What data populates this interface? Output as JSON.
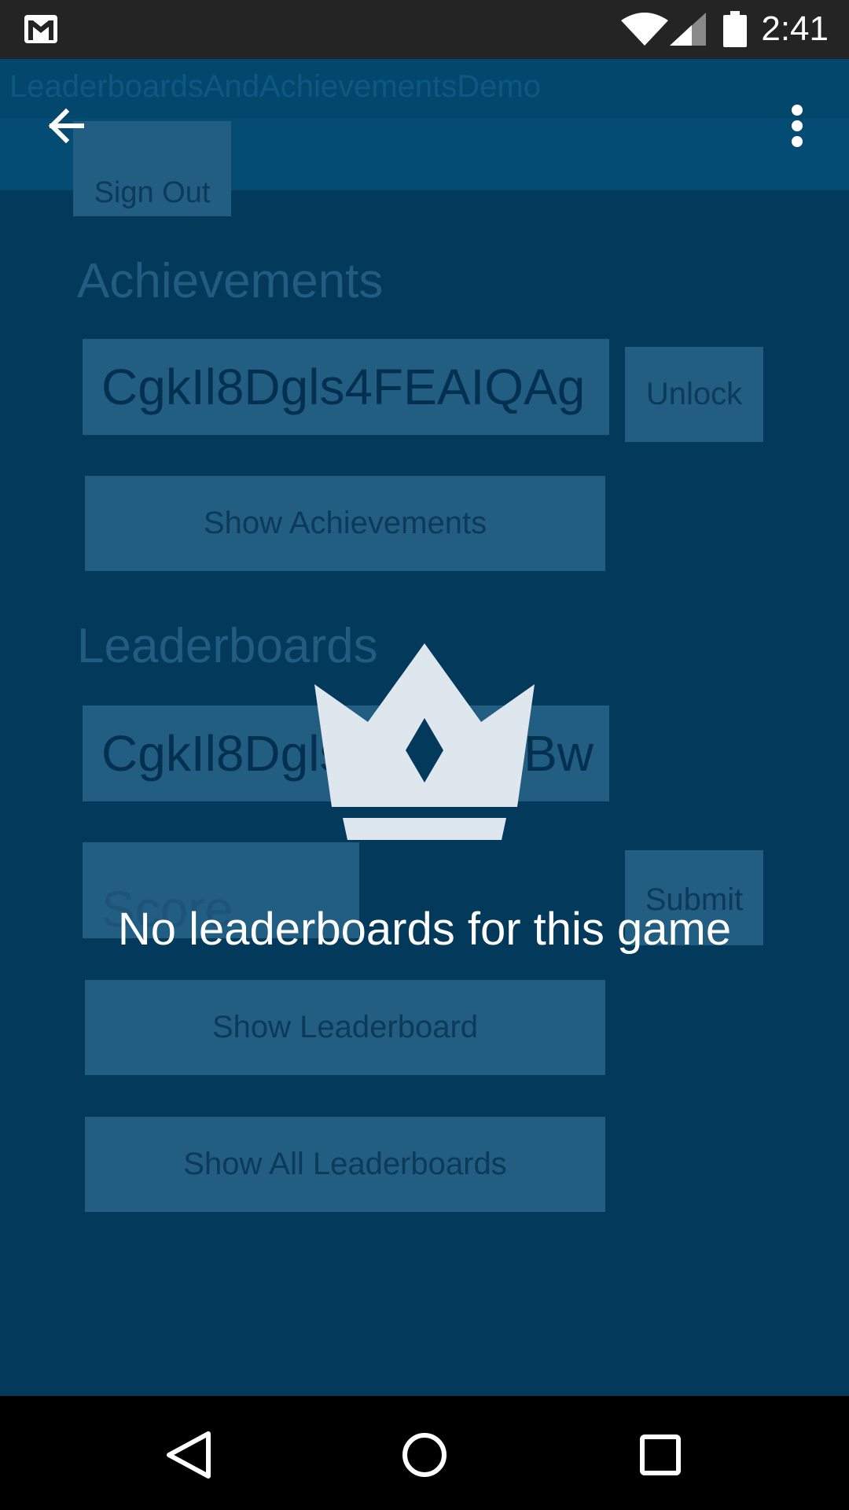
{
  "status_bar": {
    "time": "2:41",
    "icons": [
      "gmail-icon",
      "wifi-icon",
      "cell-signal-icon",
      "battery-icon"
    ]
  },
  "toolbar": {
    "title": "LeaderboardsAndAchievementsDemo",
    "back_icon": "arrow-back-icon",
    "overflow_icon": "more-vert-icon"
  },
  "background_app": {
    "sign_out_label": "Sign Out",
    "achievements_heading": "Achievements",
    "achievement_id": "CgkIl8Dgls4FEAIQAg",
    "unlock_label": "Unlock",
    "show_achievements_label": "Show Achievements",
    "leaderboards_heading": "Leaderboards",
    "leaderboard_id": "CgkIl8Dgls4FEAIQBw",
    "score_placeholder": "Score",
    "submit_label": "Submit",
    "show_leaderboard_label": "Show Leaderboard",
    "show_all_leaderboards_label": "Show All Leaderboards"
  },
  "empty_state": {
    "icon": "crown-icon",
    "message": "No leaderboards for this game"
  },
  "nav_bar": {
    "icons": [
      "back-triangle-icon",
      "home-circle-icon",
      "recents-square-icon"
    ]
  },
  "colors": {
    "background": "#033a5c",
    "toolbar": "#054c74",
    "status_bar": "#242424",
    "ghost_control": "#225d82",
    "crown": "#dfe7ee"
  }
}
